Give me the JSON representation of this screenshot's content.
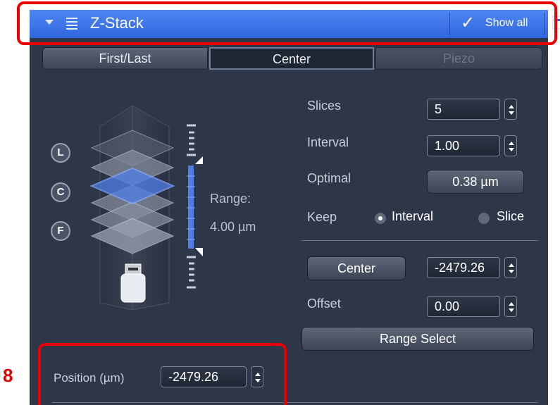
{
  "header": {
    "title": "Z-Stack",
    "show_all": "Show all",
    "checkmark": "✓"
  },
  "tabs": [
    {
      "label": "First/Last",
      "active": false,
      "enabled": true
    },
    {
      "label": "Center",
      "active": true,
      "enabled": true
    },
    {
      "label": "Piezo",
      "active": false,
      "enabled": false
    }
  ],
  "stack_markers": [
    "L",
    "C",
    "F"
  ],
  "range": {
    "label": "Range:",
    "value": "4.00 µm"
  },
  "slices": {
    "label": "Slices",
    "value": "5"
  },
  "interval": {
    "label": "Interval",
    "value": "1.00"
  },
  "optimal": {
    "label": "Optimal",
    "value": "0.38 µm"
  },
  "keep": {
    "label": "Keep",
    "options": [
      {
        "label": "Interval",
        "selected": true
      },
      {
        "label": "Slice",
        "selected": false
      }
    ]
  },
  "center": {
    "button_label": "Center",
    "value": "-2479.26"
  },
  "offset": {
    "label": "Offset",
    "value": "0.00"
  },
  "range_select": {
    "label": "Range Select"
  },
  "position": {
    "label": "Position (µm)",
    "value": "-2479.26"
  },
  "annotation": {
    "step_number": "8"
  },
  "colors": {
    "header_blue": "#3a73e8",
    "panel_bg": "#2e3748",
    "highlight_red": "#ea0000",
    "active_slice": "#4f7ee8"
  },
  "icons": [
    "collapse-arrow-icon",
    "menu-icon",
    "checkmark-icon",
    "popout-icon",
    "objective-icon",
    "spin-arrows-icon"
  ]
}
